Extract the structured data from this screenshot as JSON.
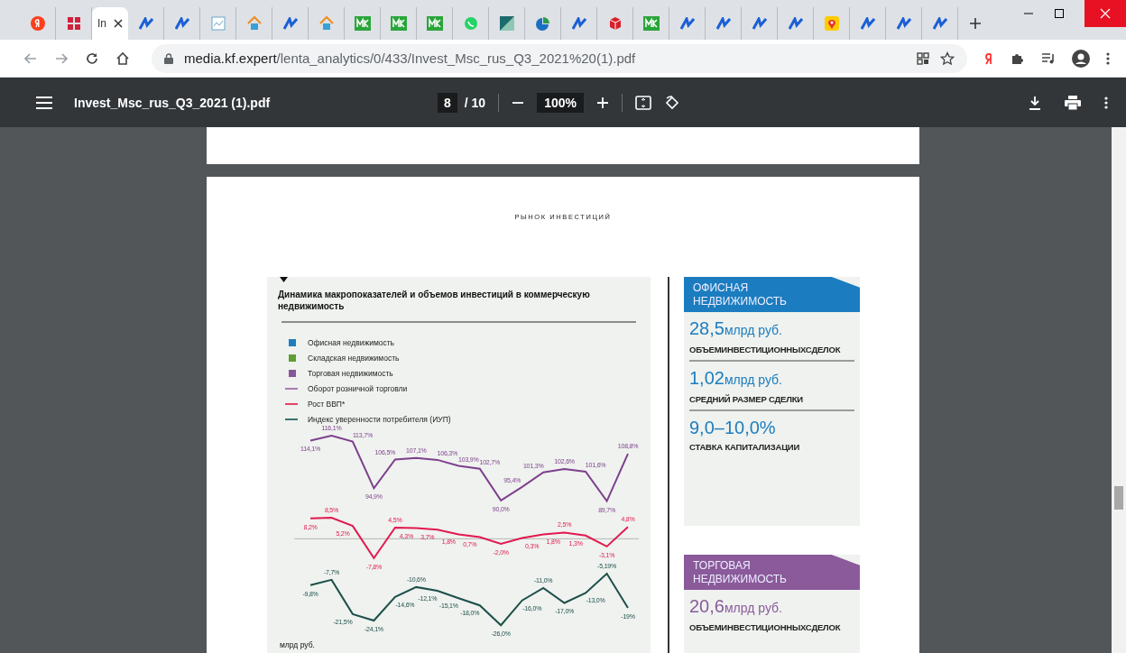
{
  "browser": {
    "tabs": [
      {
        "kind": "yandex",
        "selected": false
      },
      {
        "kind": "squares",
        "selected": false
      },
      {
        "kind": "pdf",
        "title": "In",
        "selected": true
      },
      {
        "kind": "kf",
        "selected": false
      },
      {
        "kind": "kf",
        "selected": false
      },
      {
        "kind": "chart",
        "selected": false
      },
      {
        "kind": "home",
        "selected": false
      },
      {
        "kind": "kf",
        "selected": false
      },
      {
        "kind": "home",
        "selected": false
      },
      {
        "kind": "mk",
        "selected": false
      },
      {
        "kind": "mk",
        "selected": false
      },
      {
        "kind": "mk",
        "selected": false
      },
      {
        "kind": "whatsapp",
        "selected": false
      },
      {
        "kind": "triangle",
        "selected": false
      },
      {
        "kind": "pie",
        "selected": false
      },
      {
        "kind": "kf",
        "selected": false
      },
      {
        "kind": "cube",
        "selected": false
      },
      {
        "kind": "mk",
        "selected": false
      },
      {
        "kind": "kf",
        "selected": false
      },
      {
        "kind": "kf",
        "selected": false
      },
      {
        "kind": "kf",
        "selected": false
      },
      {
        "kind": "kf",
        "selected": false
      },
      {
        "kind": "pin",
        "selected": false
      },
      {
        "kind": "kf",
        "selected": false
      },
      {
        "kind": "kf",
        "selected": false
      },
      {
        "kind": "kf",
        "selected": false
      }
    ],
    "url_host": "media.kf.expert",
    "url_path": "/lenta_analytics/0/433/Invest_Msc_rus_Q3_2021%20(1).pdf"
  },
  "pdf_toolbar": {
    "title": "Invest_Msc_rus_Q3_2021 (1).pdf",
    "page": "8",
    "page_total": "/ 10",
    "zoom": "100%"
  },
  "page": {
    "section_title": "РЫНОК ИНВЕСТИЦИЙ",
    "chart_panel": {
      "title": "Динамика макропоказателей и объемов инвестиций в коммерческую недвижимость",
      "legend": [
        {
          "kind": "square",
          "color": "#1f7dbf",
          "label": "Офисная недвижимость"
        },
        {
          "kind": "square",
          "color": "#5e9e32",
          "label": "Складская недвижимость"
        },
        {
          "kind": "square",
          "color": "#88579a",
          "label": "Торговая недвижимость"
        },
        {
          "kind": "line",
          "color": "#a77bb0",
          "label": "Оборот розничной торговли"
        },
        {
          "kind": "line",
          "color": "#e8416a",
          "label": "Рост ВВП*"
        },
        {
          "kind": "line",
          "color": "#3a7472",
          "label": "Индекс уверенности потребителя (ИУП)"
        }
      ],
      "line_charts": [
        {
          "chart_data": {
            "type": "line",
            "data_labels": true,
            "series": [
              {
                "color": "#7e3f8c",
                "values": [
                  114.1,
                  116.1,
                  113.7,
                  94.9,
                  106.5,
                  107.1,
                  106.3,
                  103.9,
                  102.7,
                  90.0,
                  95.4,
                  101.3,
                  102.6,
                  101.6,
                  89.7,
                  108.8
                ],
                "value_labels": [
                  "114,1%",
                  "116,1%",
                  "113,7%",
                  "94,9%",
                  "106,5%",
                  "107,1%",
                  "106,3%",
                  "103,9%",
                  "102,7%",
                  "90,0%",
                  "95,4%",
                  "101,3%",
                  "102,6%",
                  "101,6%",
                  "89,7%",
                  "108,8%"
                ]
              }
            ]
          }
        },
        {
          "chart_data": {
            "type": "line",
            "data_labels": true,
            "series": [
              {
                "color": "#e2194f",
                "values": [
                  8.2,
                  8.5,
                  5.2,
                  -7.8,
                  4.5,
                  4.3,
                  3.7,
                  1.8,
                  0.7,
                  -2.0,
                  0.3,
                  1.8,
                  2.5,
                  1.3,
                  -3.1,
                  4.8
                ],
                "value_labels": [
                  "8,2%",
                  "8,5%",
                  "5,2%",
                  "-7,8%",
                  "4,5%",
                  "4,3%",
                  "3,7%",
                  "1,8%",
                  "0,7%",
                  "-2,0%",
                  "0,3%",
                  "1,8%",
                  "2,5%",
                  "1,3%",
                  "-3,1%",
                  "4,8%"
                ]
              }
            ]
          }
        },
        {
          "chart_data": {
            "type": "line",
            "data_labels": true,
            "series": [
              {
                "color": "#1d4f49",
                "values": [
                  -9.8,
                  -7.7,
                  -21.5,
                  -24.1,
                  -14.6,
                  -10.6,
                  -12.1,
                  -15.1,
                  -18.0,
                  -26.0,
                  -16.0,
                  -11.0,
                  -17.0,
                  -13.0,
                  -5.19,
                  -19
                ],
                "value_labels": [
                  "-9,8%",
                  "-7,7%",
                  "-21,5%",
                  "-24,1%",
                  "-14,6%",
                  "-10,6%",
                  "-12,1%",
                  "-15,1%",
                  "-18,0%",
                  "-26,0%",
                  "-16,0%",
                  "-11,0%",
                  "-17,0%",
                  "-13,0%",
                  "-5,19%",
                  "-19%"
                ]
              }
            ]
          }
        }
      ],
      "unit_note": "млрд руб."
    },
    "stat_cards": [
      {
        "title": "ОФИСНАЯ НЕДВИЖИМОСТЬ",
        "color": "#1b7dbf",
        "stats": [
          {
            "value": "28,5",
            "unit": "млрд руб.",
            "caption": "ОБЪЕМИНВЕСТИЦИОННЫХСДЕЛОК"
          },
          {
            "value": "1,02",
            "unit": "млрд руб.",
            "caption": "СРЕДНИЙ РАЗМЕР СДЕЛКИ"
          },
          {
            "value": "9,0–10,0%",
            "caption": "СТАВКА КАПИТАЛИЗАЦИИ"
          }
        ]
      },
      {
        "title": "ТОРГОВАЯ НЕДВИЖИМОСТЬ",
        "color": "#8a5a9b",
        "stats": [
          {
            "value": "20,6",
            "unit": "млрд руб.",
            "caption": "ОБЪЕМИНВЕСТИЦИОННЫХСДЕЛОК"
          }
        ]
      }
    ]
  }
}
